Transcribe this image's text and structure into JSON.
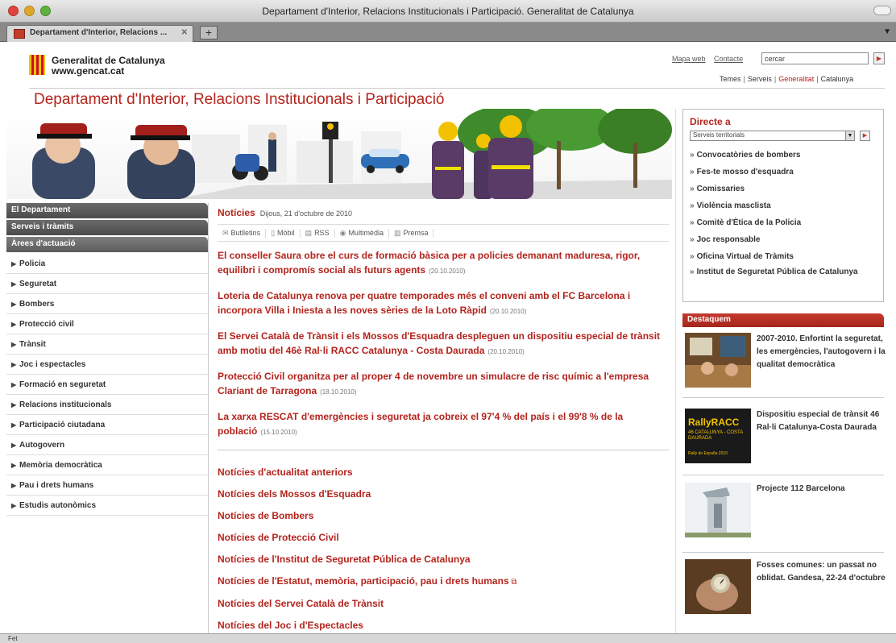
{
  "window": {
    "title": "Departament d'Interior, Relacions Institucionals i Participació. Generalitat de Catalunya",
    "tab_label": "Departament d'Interior, Relacions ...",
    "tab_add": "+",
    "status": "Fet"
  },
  "header": {
    "logo_name": "Generalitat de Catalunya",
    "logo_url": "www.gencat.cat",
    "links": [
      "Mapa web",
      "Contacte"
    ],
    "search_value": "cercar",
    "portal_nav": [
      "Temes",
      "Serveis",
      "Generalitat",
      "Catalunya"
    ],
    "dept_title": "Departament d'Interior, Relacions Institucionals i Participació"
  },
  "left_nav": {
    "sections": [
      "El Departament",
      "Serveis i tràmits",
      "Àrees d'actuació"
    ],
    "items": [
      "Policia",
      "Seguretat",
      "Bombers",
      "Protecció civil",
      "Trànsit",
      "Joc i espectacles",
      "Formació en seguretat",
      "Relacions institucionals",
      "Participació ciutadana",
      "Autogovern",
      "Memòria democràtica",
      "Pau i drets humans",
      "Estudis autonòmics"
    ]
  },
  "news": {
    "title": "Notícies",
    "date": "Dijous, 21 d'octubre de 2010",
    "tools": [
      "Butlletins",
      "Mòbil",
      "RSS",
      "Multimèdia",
      "Premsa"
    ],
    "items": [
      {
        "text": "El conseller Saura obre el curs de formació bàsica per a policies demanant maduresa, rigor, equilibri i compromís social als futurs agents",
        "date": "(20.10.2010)"
      },
      {
        "text": "Loteria de Catalunya renova per quatre temporades més el conveni amb el FC Barcelona i incorpora Villa i Iniesta a les noves sèries de la Loto Ràpid",
        "date": "(20.10.2010)"
      },
      {
        "text": "El Servei Català de Trànsit i els Mossos d'Esquadra despleguen un dispositiu especial de trànsit amb motiu del 46è Ral·li RACC Catalunya - Costa Daurada",
        "date": "(20.10.2010)"
      },
      {
        "text": "Protecció Civil organitza per al proper 4 de novembre un simulacre de risc químic a l'empresa Clariant de Tarragona",
        "date": "(18.10.2010)"
      },
      {
        "text": "La xarxa RESCAT d'emergències i seguretat ja cobreix el 97'4 % del país i el 99'8 % de la població",
        "date": "(15.10.2010)"
      }
    ],
    "more_links": [
      "Notícies d'actualitat anteriors",
      "Notícies dels Mossos d'Esquadra",
      "Notícies de Bombers",
      "Notícies de Protecció Civil",
      "Notícies de l'Institut de Seguretat Pública de Catalunya",
      "Notícies de l'Estatut, memòria, participació, pau i drets humans",
      "Notícies del Servei Català de Trànsit",
      "Notícies del Joc i d'Espectacles"
    ]
  },
  "directe": {
    "title": "Directe a",
    "select_value": "Serveis territorials",
    "links": [
      "Convocatòries de bombers",
      "Fes-te mosso d'esquadra",
      "Comissaries",
      "Violència masclista",
      "Comitè d'Ètica de la Policia",
      "Joc responsable",
      "Oficina Virtual de Tràmits",
      "Institut de Seguretat Pública de Catalunya"
    ]
  },
  "destaquem": {
    "title": "Destaquem",
    "items": [
      {
        "text": "2007-2010. Enfortint la seguretat, les emergències, l'autogovern i la qualitat democràtica",
        "thumb": "office-photo"
      },
      {
        "text": "Dispositiu especial de trànsit 46 Ral·li Catalunya-Costa Daurada",
        "thumb": "rallyracc-logo",
        "thumb_text": [
          "RallyRACC",
          "46 CATALUNYA - COSTA DAURADA",
          "Rally de España 2010"
        ]
      },
      {
        "text": "Projecte 112 Barcelona",
        "thumb": "building-photo"
      },
      {
        "text": "Fosses comunes: un passat no oblidat. Gandesa, 22-24 d'octubre",
        "thumb": "watch-hand-photo"
      }
    ]
  },
  "colors": {
    "accent": "#b4241d",
    "nav_grey": "#5c5c5c"
  }
}
